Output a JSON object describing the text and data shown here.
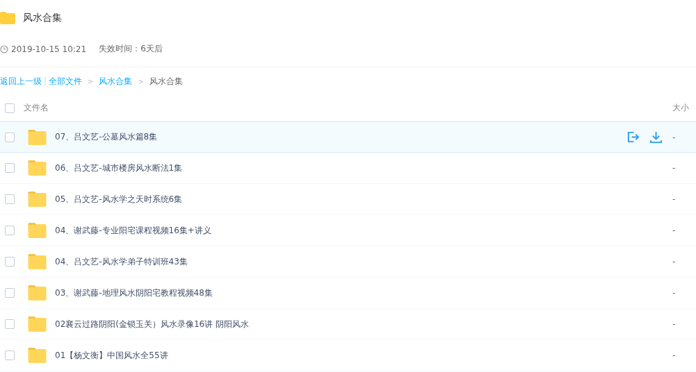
{
  "header": {
    "title": "风水合集",
    "date": "2019-10-15 10:21",
    "expiry": "失效时间：6天后"
  },
  "breadcrumb": [
    {
      "kind": "link",
      "text": "返回上一级"
    },
    {
      "kind": "bar",
      "text": "|"
    },
    {
      "kind": "link",
      "text": "全部文件"
    },
    {
      "kind": "arrow",
      "text": ">"
    },
    {
      "kind": "link",
      "text": "风水合集"
    },
    {
      "kind": "arrow",
      "text": ">"
    },
    {
      "kind": "current",
      "text": "风水合集"
    }
  ],
  "table": {
    "columns": [
      "文件名",
      "大小"
    ],
    "select_all_checked": false,
    "rows": [
      {
        "name": "07、吕文艺-公墓风水篇8集",
        "size": "-",
        "checked": false,
        "hovered": true
      },
      {
        "name": "06、吕文艺-城市楼房风水断法1集",
        "size": "-",
        "checked": false,
        "hovered": false
      },
      {
        "name": "05、吕文艺-风水学之天时系统6集",
        "size": "-",
        "checked": false,
        "hovered": false
      },
      {
        "name": "04、谢武藤-专业阳宅课程视频16集+讲义",
        "size": "-",
        "checked": false,
        "hovered": false
      },
      {
        "name": "04、吕文艺-风水学弟子特训班43集",
        "size": "-",
        "checked": false,
        "hovered": false
      },
      {
        "name": "03、谢武藤-地理风水阴阳宅教程视频48集",
        "size": "-",
        "checked": false,
        "hovered": false
      },
      {
        "name": "02襄云过路阴阳(金锁玉关）风水录像16讲 阴阳风水",
        "size": "-",
        "checked": false,
        "hovered": false
      },
      {
        "name": "01【杨文衡】中国风水全55讲",
        "size": "-",
        "checked": false,
        "hovered": false
      }
    ]
  }
}
